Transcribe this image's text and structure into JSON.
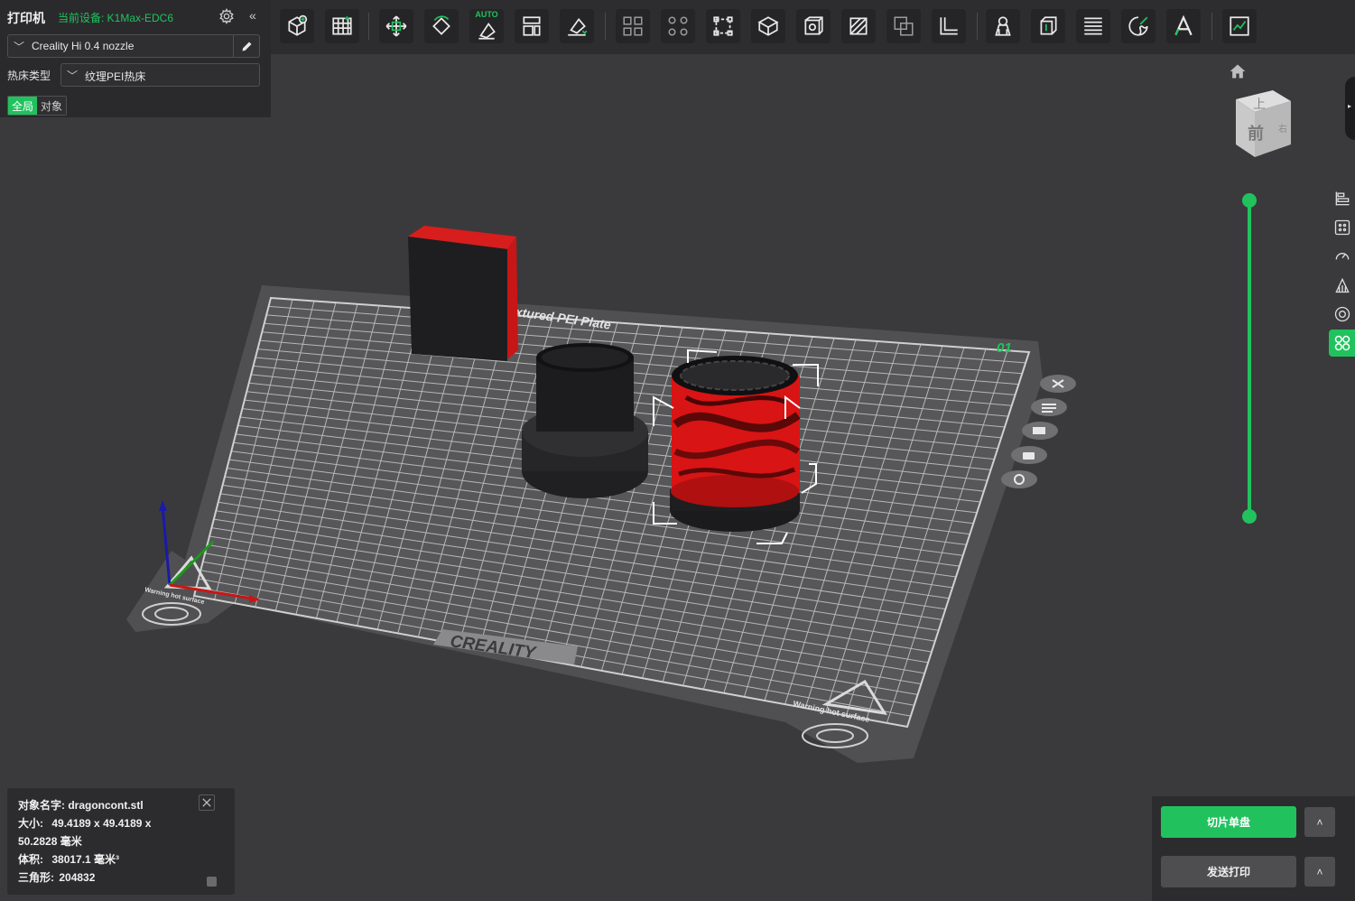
{
  "printer_panel": {
    "title": "打印机",
    "device_label": "当前设备: K1Max-EDC6",
    "nozzle": "Creality Hi 0.4 nozzle",
    "bed_type_label": "热床类型",
    "bed_type_value": "纹理PEI热床",
    "tabs": [
      "全局",
      "对象"
    ],
    "active_tab": "全局"
  },
  "toolbar": {
    "icons": [
      "add-object-icon",
      "arrange-grid-icon",
      "move-icon",
      "rotate-icon",
      "auto-orient-icon",
      "split-layout-icon",
      "lay-on-face-icon",
      "arrange-icon",
      "distribute-icon",
      "scale-box-icon",
      "cube-view-icon",
      "cut-icon",
      "hollow-icon",
      "boolean-icon",
      "measure-icon",
      "support-paint-icon",
      "seam-icon",
      "layers-icon",
      "color-paint-icon",
      "text-icon",
      "assembly-icon"
    ],
    "auto_label": "AUTO"
  },
  "plate": {
    "brand_label": "Creality Textured PEI Plate",
    "logo_text": "CREALITY",
    "plate_number": "01",
    "warning_text": "Warning hot surface"
  },
  "view": {
    "cube_top": "上",
    "cube_front": "前",
    "cube_side": "右"
  },
  "object_info": {
    "name_label": "对象名字:",
    "name_value": "dragoncont.stl",
    "size_label": "大小:",
    "size_value_line1": "49.4189 x 49.4189 x",
    "size_value_line2": "50.2828 毫米",
    "volume_label": "体积:",
    "volume_value": "38017.1 毫米³",
    "triangles_label": "三角形:",
    "triangles_value": "204832"
  },
  "actions": {
    "slice_label": "切片单盘",
    "send_label": "发送打印",
    "caret": "˄"
  },
  "colors": {
    "accent": "#21c25e",
    "selected_object": "#e01818"
  }
}
